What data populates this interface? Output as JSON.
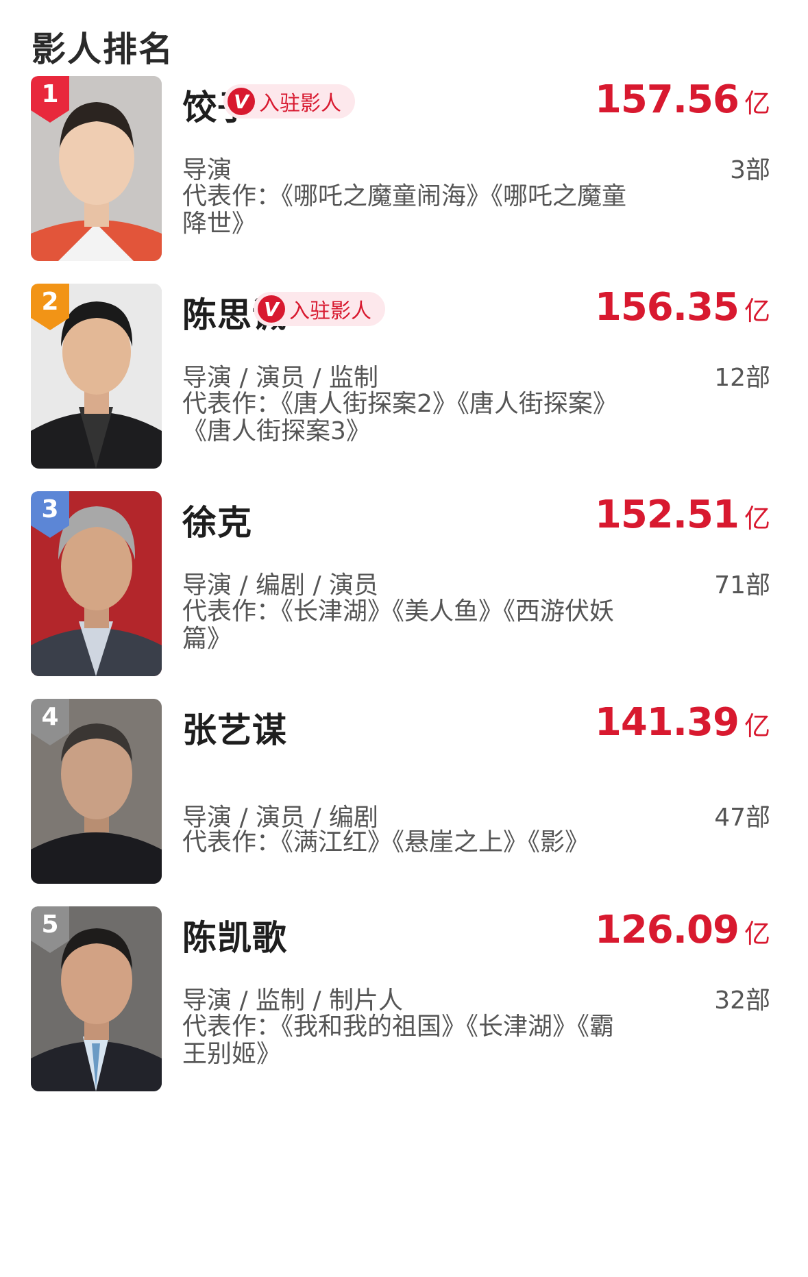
{
  "page": {
    "title": "影人排名"
  },
  "verified_label": "入驻影人",
  "rankings": [
    {
      "rank": "1",
      "name": "饺子",
      "verified": true,
      "box_office": "157.56",
      "unit": "亿",
      "roles": "导演",
      "count": "3部",
      "works": "代表作：《哪吒之魔童闹海》《哪吒之魔童降世》",
      "badge_color": "#e8283c"
    },
    {
      "rank": "2",
      "name": "陈思诚",
      "verified": true,
      "box_office": "156.35",
      "unit": "亿",
      "roles": "导演 / 演员 / 监制",
      "count": "12部",
      "works": "代表作：《唐人街探案2》《唐人街探案》《唐人街探案3》",
      "badge_color": "#f29416"
    },
    {
      "rank": "3",
      "name": "徐克",
      "verified": false,
      "box_office": "152.51",
      "unit": "亿",
      "roles": "导演 / 编剧 / 演员",
      "count": "71部",
      "works": "代表作：《长津湖》《美人鱼》《西游伏妖篇》",
      "badge_color": "#5c86d6"
    },
    {
      "rank": "4",
      "name": "张艺谋",
      "verified": false,
      "box_office": "141.39",
      "unit": "亿",
      "roles": "导演 / 演员 / 编剧",
      "count": "47部",
      "works": "代表作：《满江红》《悬崖之上》《影》",
      "badge_color": "#8f8f8f"
    },
    {
      "rank": "5",
      "name": "陈凯歌",
      "verified": false,
      "box_office": "126.09",
      "unit": "亿",
      "roles": "导演 / 监制 / 制片人",
      "count": "32部",
      "works": "代表作：《我和我的祖国》《长津湖》《霸王别姬》",
      "badge_color": "#8f8f8f"
    }
  ]
}
